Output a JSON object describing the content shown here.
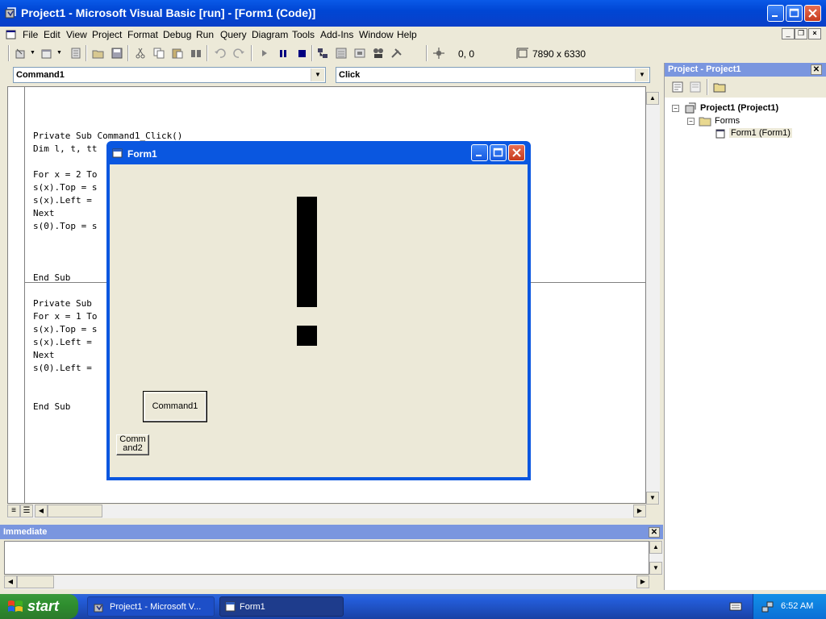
{
  "titlebar": {
    "title": "Project1 - Microsoft Visual Basic [run] - [Form1 (Code)]"
  },
  "menubar": {
    "items": [
      "File",
      "Edit",
      "View",
      "Project",
      "Format",
      "Debug",
      "Run",
      "Query",
      "Diagram",
      "Tools",
      "Add-Ins",
      "Window",
      "Help"
    ]
  },
  "toolbar": {
    "coords": "0, 0",
    "dims": "7890 x 6330"
  },
  "code_window": {
    "object_combo": "Command1",
    "proc_combo": "Click",
    "lines": [
      "Private Sub Command1_Click()",
      "Dim l, t, tt",
      "",
      "For x = 2 To",
      "s(x).Top = s",
      "s(x).Left =",
      "Next",
      "s(0).Top = s",
      "",
      "",
      "",
      "End Sub",
      "",
      "Private Sub",
      "For x = 1 To",
      "s(x).Top = s",
      "s(x).Left =",
      "Next",
      "s(0).Left =",
      "",
      "",
      "End Sub"
    ]
  },
  "form1": {
    "title": "Form1",
    "command1_label": "Command1",
    "command2_label": "Comm and2"
  },
  "project_panel": {
    "title": "Project - Project1",
    "root": "Project1 (Project1)",
    "folder": "Forms",
    "form": "Form1 (Form1)"
  },
  "immediate": {
    "title": "Immediate"
  },
  "taskbar": {
    "start": "start",
    "tasks": [
      "Project1 - Microsoft V...",
      "Form1"
    ],
    "clock": "6:52 AM"
  }
}
